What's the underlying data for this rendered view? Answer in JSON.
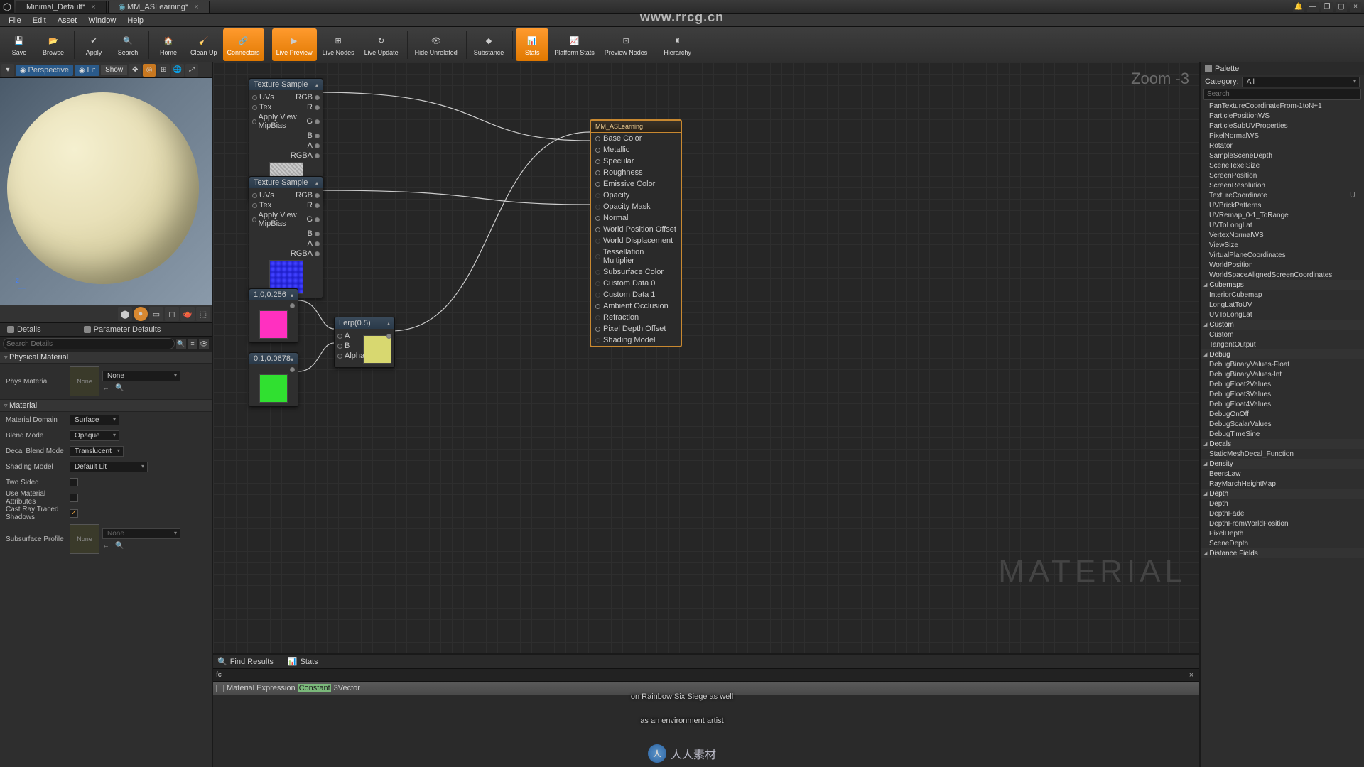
{
  "watermark_url": "www.rrcg.cn",
  "tabs": {
    "t0": "Minimal_Default*",
    "t1": "MM_ASLearning*"
  },
  "menubar": [
    "File",
    "Edit",
    "Asset",
    "Window",
    "Help"
  ],
  "toolbar": {
    "save": "Save",
    "browse": "Browse",
    "apply": "Apply",
    "search": "Search",
    "home": "Home",
    "cleanup": "Clean Up",
    "connectors": "Connectors",
    "livepreview": "Live Preview",
    "livenodes": "Live Nodes",
    "liveupdate": "Live Update",
    "hideunrelated": "Hide Unrelated",
    "substance": "Substance",
    "stats": "Stats",
    "platformstats": "Platform Stats",
    "previewnodes": "Preview Nodes",
    "hierarchy": "Hierarchy"
  },
  "viewport": {
    "persp": "Perspective",
    "lit": "Lit",
    "show": "Show"
  },
  "zoom_label": "Zoom -3",
  "material_wm": "MATERIAL",
  "panels": {
    "details": "Details",
    "paramdefaults": "Parameter Defaults"
  },
  "search_placeholder": "Search Details",
  "cats": {
    "physmat": "Physical Material",
    "material": "Material"
  },
  "props": {
    "physmat_lbl": "Phys Material",
    "physmat_val": "None",
    "physmat_thumb": "None",
    "domain_lbl": "Material Domain",
    "domain_val": "Surface",
    "blend_lbl": "Blend Mode",
    "blend_val": "Opaque",
    "decal_lbl": "Decal Blend Mode",
    "decal_val": "Translucent",
    "shading_lbl": "Shading Model",
    "shading_val": "Default Lit",
    "twosided_lbl": "Two Sided",
    "useattr_lbl": "Use Material Attributes",
    "castray_lbl": "Cast Ray Traced Shadows",
    "subsurf_lbl": "Subsurface Profile",
    "subsurf_val": "None",
    "subsurf_thumb": "None"
  },
  "nodes": {
    "tex_sample": "Texture Sample",
    "uvs": "UVs",
    "tex": "Tex",
    "mip": "Apply View MipBias",
    "rgb": "RGB",
    "r": "R",
    "g": "G",
    "b": "B",
    "a": "A",
    "rgba": "RGBA",
    "const1": "1,0,0.256",
    "const2": "0,1,0.0678",
    "lerp": "Lerp(0.5)",
    "lerp_a": "A",
    "lerp_b": "B",
    "lerp_alpha": "Alpha",
    "result_title": "MM_ASLearning",
    "pins": {
      "base": "Base Color",
      "metallic": "Metallic",
      "specular": "Specular",
      "rough": "Roughness",
      "emissive": "Emissive Color",
      "opacity": "Opacity",
      "opmask": "Opacity Mask",
      "normal": "Normal",
      "wpo": "World Position Offset",
      "wd": "World Displacement",
      "tm": "Tessellation Multiplier",
      "ss": "Subsurface Color",
      "cd0": "Custom Data 0",
      "cd1": "Custom Data 1",
      "ao": "Ambient Occlusion",
      "refr": "Refraction",
      "pdo": "Pixel Depth Offset",
      "shm": "Shading Model"
    }
  },
  "bottom": {
    "find": "Find Results",
    "stats": "Stats",
    "fc": "fc",
    "expr_pre": "Material Expression ",
    "expr_hl": "Constant",
    "expr_post": "3Vector"
  },
  "subtitle_l1": "on Rainbow Six Siege as well",
  "subtitle_l2": "as an environment artist",
  "footer_text": "人人素材",
  "palette": {
    "title": "Palette",
    "cat_lbl": "Category:",
    "cat_val": "All",
    "search": "Search",
    "items1": [
      "PanTextureCoordinateFrom-1toN+1",
      "ParticlePositionWS",
      "ParticleSubUVProperties",
      "PixelNormalWS",
      "Rotator",
      "SampleSceneDepth",
      "SceneTexelSize",
      "ScreenPosition",
      "ScreenResolution"
    ],
    "texcoord": "TextureCoordinate",
    "texcoord_sc": "U",
    "items2": [
      "UVBrickPatterns",
      "UVRemap_0-1_ToRange",
      "UVToLongLat",
      "VertexNormalWS",
      "ViewSize",
      "VirtualPlaneCoordinates",
      "WorldPosition",
      "WorldSpaceAlignedScreenCoordinates"
    ],
    "g_cubemaps": "Cubemaps",
    "cubemaps": [
      "InteriorCubemap",
      "LongLatToUV",
      "UVToLongLat"
    ],
    "g_custom": "Custom",
    "custom": [
      "Custom",
      "TangentOutput"
    ],
    "g_debug": "Debug",
    "debug": [
      "DebugBinaryValues-Float",
      "DebugBinaryValues-Int",
      "DebugFloat2Values",
      "DebugFloat3Values",
      "DebugFloat4Values",
      "DebugOnOff",
      "DebugScalarValues",
      "DebugTimeSine"
    ],
    "g_decals": "Decals",
    "decals": [
      "StaticMeshDecal_Function"
    ],
    "g_density": "Density",
    "density": [
      "BeersLaw",
      "RayMarchHeightMap"
    ],
    "g_depth": "Depth",
    "depth": [
      "Depth",
      "DepthFade",
      "DepthFromWorldPosition",
      "PixelDepth",
      "SceneDepth"
    ],
    "g_distfields": "Distance Fields"
  }
}
